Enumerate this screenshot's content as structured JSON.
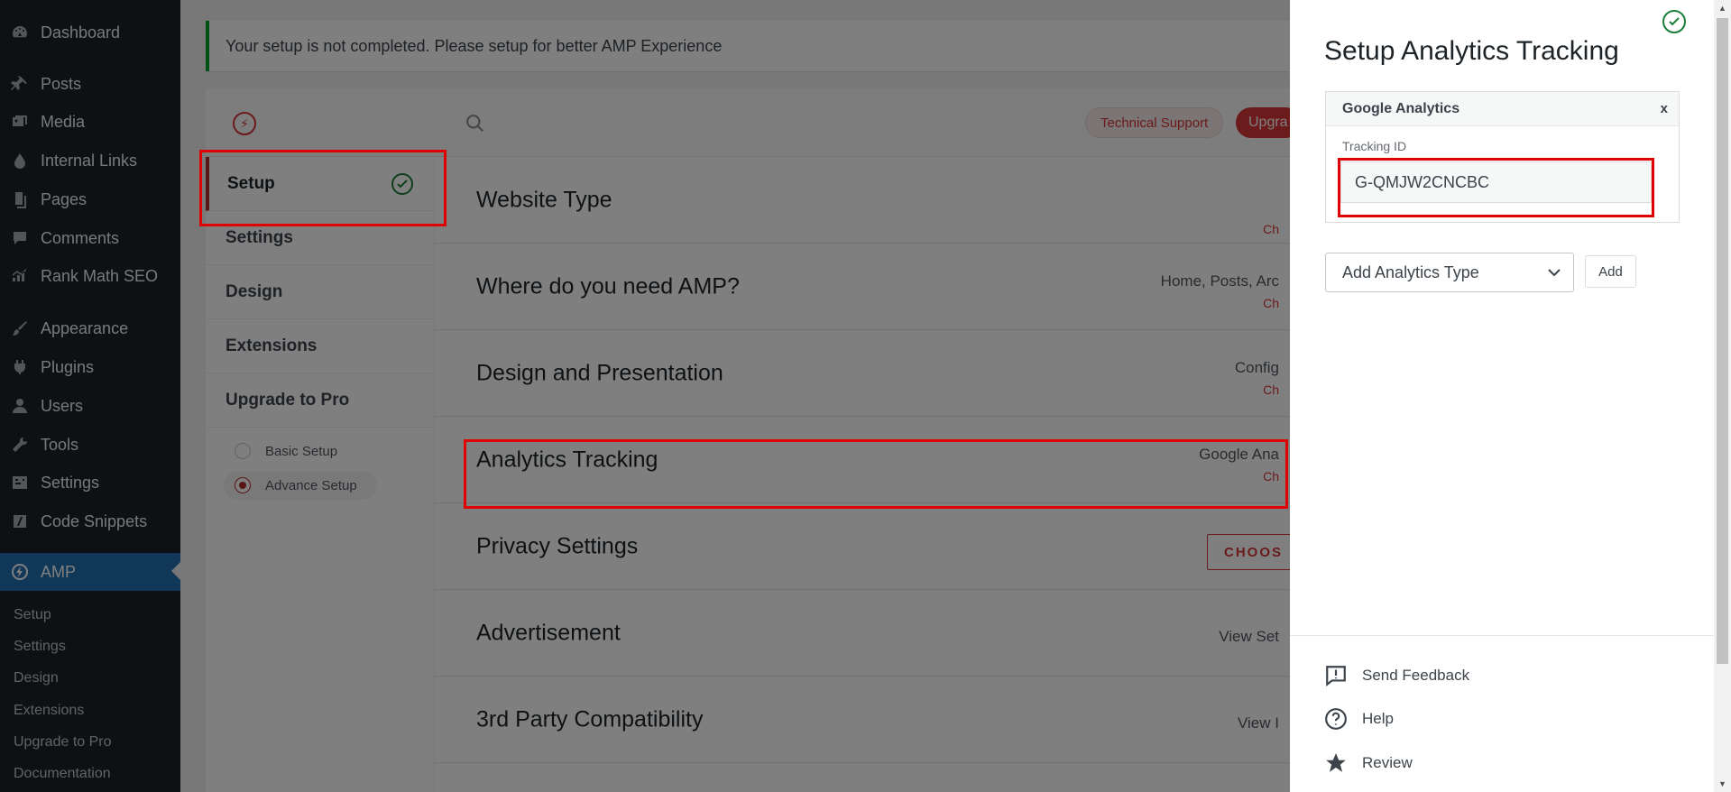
{
  "admin_menu": {
    "items": [
      {
        "label": "Dashboard",
        "icon": "dashboard-icon"
      },
      {
        "label": "Posts",
        "icon": "pin-icon"
      },
      {
        "label": "Media",
        "icon": "media-icon"
      },
      {
        "label": "Internal Links",
        "icon": "drop-icon"
      },
      {
        "label": "Pages",
        "icon": "page-icon"
      },
      {
        "label": "Comments",
        "icon": "comment-icon"
      },
      {
        "label": "Rank Math SEO",
        "icon": "chart-icon"
      },
      {
        "label": "Appearance",
        "icon": "brush-icon"
      },
      {
        "label": "Plugins",
        "icon": "plug-icon"
      },
      {
        "label": "Users",
        "icon": "user-icon"
      },
      {
        "label": "Tools",
        "icon": "wrench-icon"
      },
      {
        "label": "Settings",
        "icon": "sliders-icon"
      },
      {
        "label": "Code Snippets",
        "icon": "code-icon"
      },
      {
        "label": "AMP",
        "icon": "amp-icon"
      }
    ],
    "submenu": [
      "Setup",
      "Settings",
      "Design",
      "Extensions",
      "Upgrade to Pro",
      "Documentation"
    ]
  },
  "notice": {
    "text": "Your setup is not completed. Please setup for better AMP Experience"
  },
  "topbar": {
    "tech_support": "Technical Support",
    "upgrade": "Upgra"
  },
  "setup_nav": {
    "items": [
      "Setup",
      "Settings",
      "Design",
      "Extensions",
      "Upgrade to Pro"
    ],
    "modes": [
      {
        "label": "Basic Setup",
        "selected": false
      },
      {
        "label": "Advance Setup",
        "selected": true
      }
    ]
  },
  "setup_rows": [
    {
      "title": "Website Type",
      "value": "",
      "change": "Ch"
    },
    {
      "title": "Where do you need AMP?",
      "value": "Home, Posts, Arc",
      "change": "Ch"
    },
    {
      "title": "Design and Presentation",
      "value": "Config",
      "change": "Ch"
    },
    {
      "title": "Analytics Tracking",
      "value": "Google Ana",
      "change": "Ch"
    },
    {
      "title": "Privacy Settings",
      "value": "",
      "change": "",
      "button": "CHOOS"
    },
    {
      "title": "Advertisement",
      "value": "View Set",
      "change": ""
    },
    {
      "title": "3rd Party Compatibility",
      "value": "View I",
      "change": ""
    }
  ],
  "drawer": {
    "title": "Setup Analytics Tracking",
    "ga_card": {
      "title": "Google Analytics",
      "close": "x",
      "tracking_label": "Tracking ID",
      "tracking_value": "G-QMJW2CNCBC"
    },
    "select": {
      "value": "Add Analytics Type"
    },
    "add_button": "Add",
    "footer": [
      {
        "label": "Send Feedback",
        "icon": "feedback-icon"
      },
      {
        "label": "Help",
        "icon": "help-icon"
      },
      {
        "label": "Review",
        "icon": "star-icon"
      }
    ]
  }
}
